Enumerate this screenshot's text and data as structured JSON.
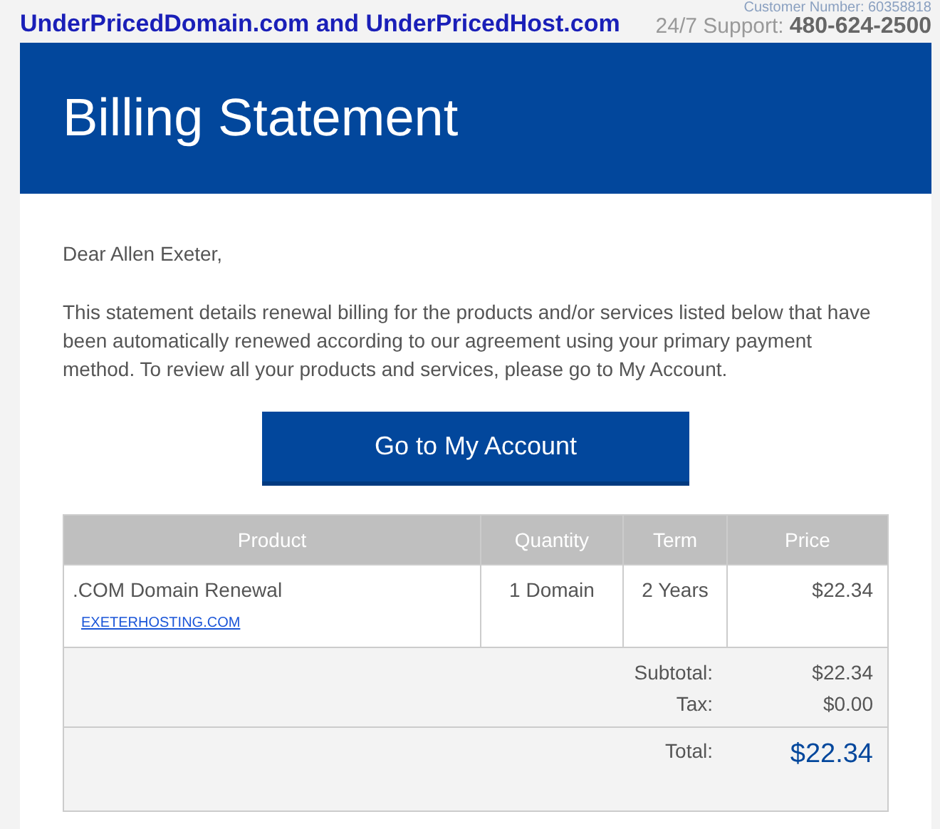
{
  "header": {
    "customer_number": "Customer Number: 60358818",
    "brand": "UnderPricedDomain.com and UnderPricedHost.com",
    "support_label": "24/7 Support:",
    "support_phone": "480-624-2500"
  },
  "banner": {
    "title": "Billing Statement"
  },
  "greeting": "Dear Allen Exeter,",
  "intro": "This statement details renewal billing for the products and/or services listed below that have been automatically renewed according to our agreement using your primary payment method. To review all your products and services, please go to My Account.",
  "account_button": "Go to My Account",
  "table": {
    "columns": [
      "Product",
      "Quantity",
      "Term",
      "Price"
    ],
    "rows": [
      {
        "product": ".COM Domain Renewal",
        "domain": "EXETERHOSTING.COM",
        "quantity": "1 Domain",
        "term": "2 Years",
        "price": "$22.34"
      }
    ],
    "subtotal_label": "Subtotal:",
    "subtotal": "$22.34",
    "tax_label": "Tax:",
    "tax": "$0.00",
    "total_label": "Total:",
    "total": "$22.34"
  }
}
